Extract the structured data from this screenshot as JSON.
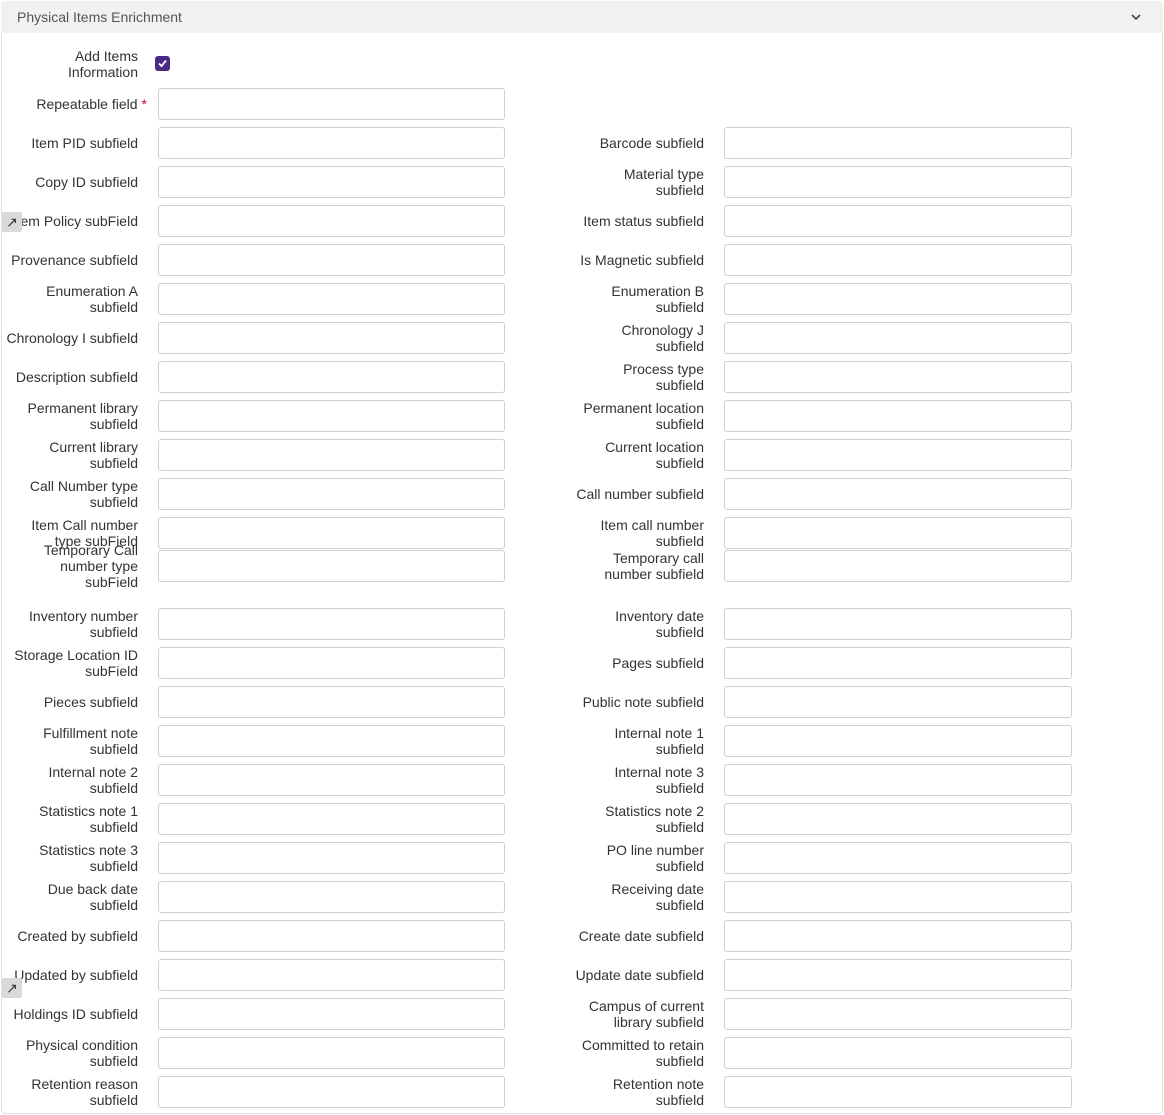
{
  "section": {
    "title": "Physical Items Enrichment",
    "collapse_icon": "chevron-down-icon"
  },
  "add_items": {
    "label_lines": [
      "Add Items",
      "Information"
    ],
    "checked": true
  },
  "repeatable": {
    "label": "Repeatable field",
    "required_mark": "*",
    "value": ""
  },
  "rows": [
    {
      "left": [
        "Item PID subfield"
      ],
      "right": [
        "Barcode subfield"
      ]
    },
    {
      "left": [
        "Copy ID subfield"
      ],
      "right": [
        "Material type",
        "subfield"
      ]
    },
    {
      "left": [
        "Item Policy subField"
      ],
      "right": [
        "Item status subfield"
      ]
    },
    {
      "left": [
        "Provenance subfield"
      ],
      "right": [
        "Is Magnetic subfield"
      ]
    },
    {
      "left": [
        "Enumeration A",
        "subfield"
      ],
      "right": [
        "Enumeration B",
        "subfield"
      ]
    },
    {
      "left": [
        "Chronology I subfield"
      ],
      "right": [
        "Chronology J",
        "subfield"
      ]
    },
    {
      "left": [
        "Description subfield"
      ],
      "right": [
        "Process type",
        "subfield"
      ]
    },
    {
      "left": [
        "Permanent library",
        "subfield"
      ],
      "right": [
        "Permanent location",
        "subfield"
      ]
    },
    {
      "left": [
        "Current library",
        "subfield"
      ],
      "right": [
        "Current location",
        "subfield"
      ]
    },
    {
      "left": [
        "Call Number type",
        "subfield"
      ],
      "right": [
        "Call number subfield"
      ]
    },
    {
      "left": [
        "Item Call number",
        "type subField"
      ],
      "right": [
        "Item call number",
        "subfield"
      ]
    },
    {
      "left": [
        "Temporary Call",
        "number type",
        "subField"
      ],
      "right": [
        "Temporary call",
        "number subfield"
      ]
    },
    {
      "left": [
        "Inventory number",
        "subfield"
      ],
      "right": [
        "Inventory date",
        "subfield"
      ]
    },
    {
      "left": [
        "Storage Location ID",
        "subField"
      ],
      "right": [
        "Pages subfield"
      ]
    },
    {
      "left": [
        "Pieces subfield"
      ],
      "right": [
        "Public note subfield"
      ]
    },
    {
      "left": [
        "Fulfillment note",
        "subfield"
      ],
      "right": [
        "Internal note 1",
        "subfield"
      ]
    },
    {
      "left": [
        "Internal note 2",
        "subfield"
      ],
      "right": [
        "Internal note 3",
        "subfield"
      ]
    },
    {
      "left": [
        "Statistics note 1",
        "subfield"
      ],
      "right": [
        "Statistics note 2",
        "subfield"
      ]
    },
    {
      "left": [
        "Statistics note 3",
        "subfield"
      ],
      "right": [
        "PO line number",
        "subfield"
      ]
    },
    {
      "left": [
        "Due back date",
        "subfield"
      ],
      "right": [
        "Receiving date",
        "subfield"
      ]
    },
    {
      "left": [
        "Created by subfield"
      ],
      "right": [
        "Create date subfield"
      ]
    },
    {
      "left": [
        "Updated by subfield"
      ],
      "right": [
        "Update date subfield"
      ]
    },
    {
      "left": [
        "Holdings ID subfield"
      ],
      "right": [
        "Campus of current",
        "library subfield"
      ]
    },
    {
      "left": [
        "Physical condition",
        "subfield"
      ],
      "right": [
        "Committed to retain",
        "subfield"
      ]
    },
    {
      "left": [
        "Retention reason",
        "subfield"
      ],
      "right": [
        "Retention note",
        "subfield"
      ]
    }
  ],
  "expand_icon": {
    "name": "expand-arrow-icon",
    "glyph": "↗"
  },
  "accent_color": "#4b2a86"
}
